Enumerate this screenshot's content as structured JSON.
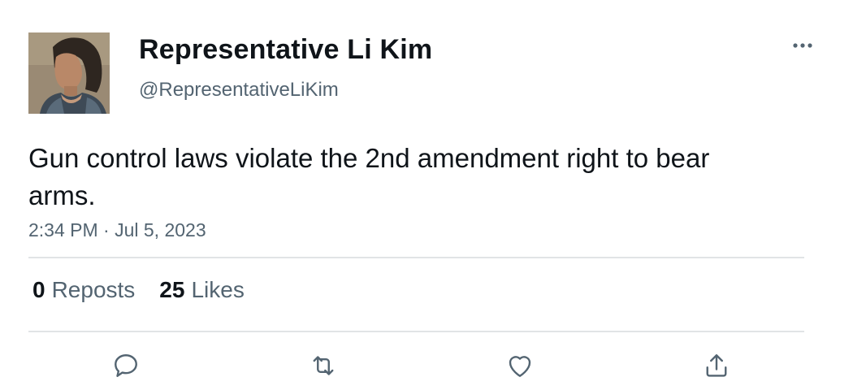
{
  "author": {
    "display_name": "Representative Li Kim",
    "handle": "@RepresentativeLiKim",
    "avatar_icon": "profile-photo"
  },
  "tweet": {
    "text": "Gun control laws violate the 2nd amendment right to bear arms.",
    "timestamp": "2:34 PM · Jul 5, 2023"
  },
  "stats": {
    "reposts_count": "0",
    "reposts_label": "Reposts",
    "likes_count": "25",
    "likes_label": "Likes"
  },
  "actions": {
    "reply_icon": "reply-icon",
    "repost_icon": "repost-icon",
    "like_icon": "heart-icon",
    "share_icon": "share-icon",
    "more_icon": "more-icon"
  },
  "colors": {
    "text_primary": "#0f1419",
    "text_secondary": "#536471",
    "divider": "#e1e4e6"
  }
}
